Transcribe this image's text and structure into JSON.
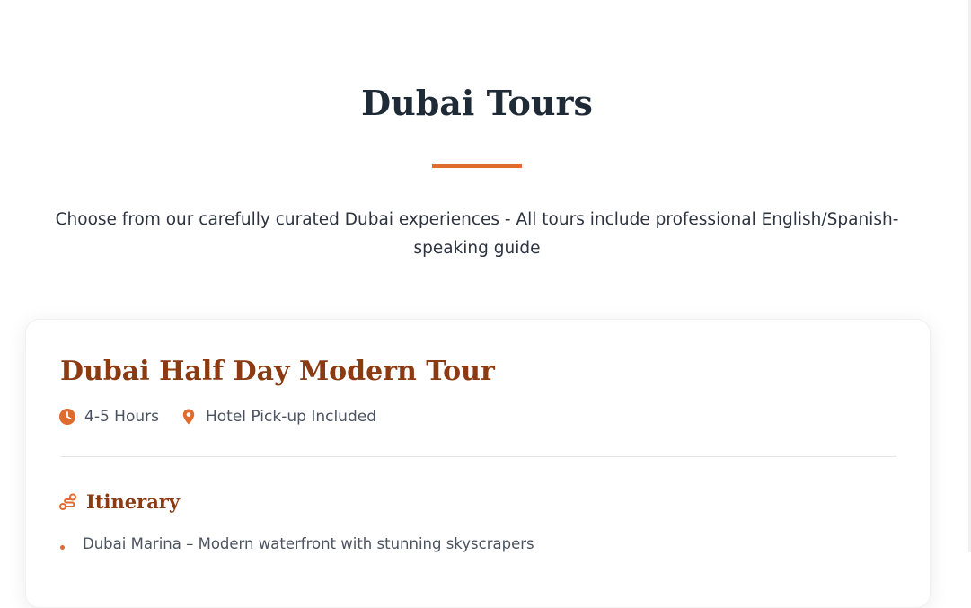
{
  "section": {
    "title": "Dubai Tours",
    "subtitle": "Choose from our carefully curated Dubai experiences - All tours include professional English/Spanish-speaking guide"
  },
  "tour": {
    "title": "Dubai Half Day Modern Tour",
    "meta": {
      "duration": "4-5 Hours",
      "pickup": "Hotel Pick-up Included"
    },
    "itinerary_title": "Itinerary",
    "itinerary": [
      "Dubai Marina – Modern waterfront with stunning skyscrapers"
    ]
  },
  "icons": {
    "duration": "clock-icon",
    "pickup": "map-pin-icon",
    "itinerary": "route-icon"
  },
  "colors": {
    "accent": "#e06b2f",
    "heading_dark": "#1f2a37",
    "tour_title": "#8b3a12",
    "body_text": "#4b5360"
  }
}
